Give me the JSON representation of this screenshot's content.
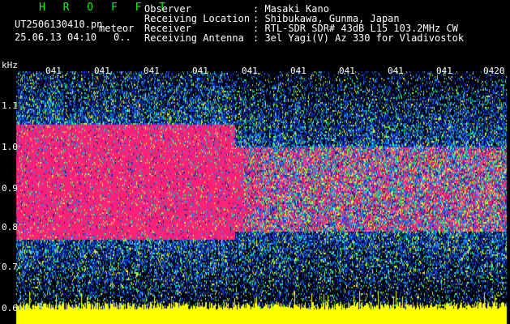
{
  "header": {
    "title": "H R O F F T",
    "filename": "UT2506130410.pn",
    "subtitle": "meteor",
    "datetime": "25.06.13 04:10",
    "status": "0..",
    "info": [
      {
        "label": "Observer",
        "value": ": Masaki Kano"
      },
      {
        "label": "Receiving Location",
        "value": ": Shibukawa, Gunma, Japan"
      },
      {
        "label": "Receiver",
        "value": ": RTL-SDR SDR# 43dB L15 103.2MHz CW"
      },
      {
        "label": "Receiving Antenna",
        "value": ": 3el Yagi(V) Az 330 for Vladivostok"
      }
    ]
  },
  "spectrogram": {
    "y_unit": "kHz",
    "y_ticks": [
      "1.1",
      "1.0",
      "0.9",
      "0.8",
      "0.7",
      "0.6"
    ],
    "x_ticks": [
      "041",
      "041",
      "041",
      "041",
      "041",
      "041",
      "041",
      "041",
      "041",
      "0420"
    ],
    "colors": {
      "background": "#000000",
      "band": "#ff2277",
      "noise_blue": "#1133dd",
      "noise_green": "#00ee88",
      "signal_yellow": "#ffff00"
    }
  }
}
